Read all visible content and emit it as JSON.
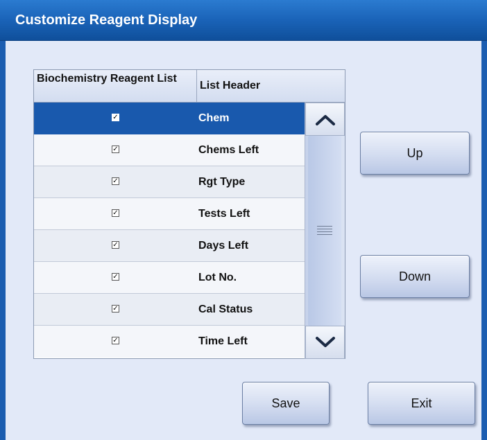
{
  "window": {
    "title": "Customize Reagent Display"
  },
  "table": {
    "headers": [
      "Biochemistry Reagent List",
      "List Header"
    ],
    "rows": [
      {
        "checked": true,
        "label": "Chem",
        "selected": true
      },
      {
        "checked": true,
        "label": "Chems Left",
        "selected": false
      },
      {
        "checked": true,
        "label": "Rgt Type",
        "selected": false
      },
      {
        "checked": true,
        "label": "Tests Left",
        "selected": false
      },
      {
        "checked": true,
        "label": "Days Left",
        "selected": false
      },
      {
        "checked": true,
        "label": "Lot No.",
        "selected": false
      },
      {
        "checked": true,
        "label": "Cal Status",
        "selected": false
      },
      {
        "checked": true,
        "label": "Time Left",
        "selected": false
      }
    ]
  },
  "buttons": {
    "up": "Up",
    "down": "Down",
    "save": "Save",
    "exit": "Exit"
  },
  "colors": {
    "title_bar": "#1a63b8",
    "selected_row": "#1959ad",
    "background": "#e2e9f8"
  },
  "icons": {
    "scroll_up": "chevron-up-icon",
    "scroll_down": "chevron-down-icon",
    "thumb_grip": "grip-lines-icon",
    "checkbox": "checkmark-icon"
  }
}
